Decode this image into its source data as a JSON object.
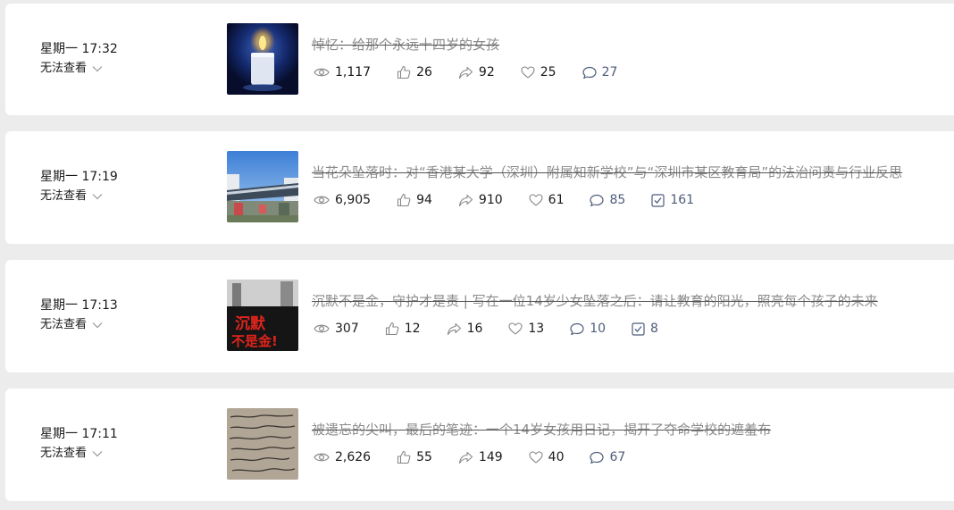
{
  "articles": [
    {
      "time": "星期一 17:32",
      "visibility": "无法查看",
      "title": "悼忆：给那个永远十四岁的女孩",
      "thumbnail": "candle-image",
      "stats": {
        "views": "1,117",
        "likes": "26",
        "shares": "92",
        "favorites": "25",
        "comments": "27"
      }
    },
    {
      "time": "星期一 17:19",
      "visibility": "无法查看",
      "title": "当花朵坠落时：对“香港某大学（深圳）附属知新学校”与“深圳市某区教育局”的法治问责与行业反思",
      "thumbnail": "school-gate-image",
      "stats": {
        "views": "6,905",
        "likes": "94",
        "shares": "910",
        "favorites": "61",
        "comments": "85",
        "checks": "161"
      }
    },
    {
      "time": "星期一 17:13",
      "visibility": "无法查看",
      "title": "沉默不是金，守护才是责 | 写在一位14岁少女坠落之后：请让教育的阳光，照亮每个孩子的未来",
      "thumbnail": "protest-sign-image",
      "thumb_text_1": "沉默",
      "thumb_text_2": "不是金!",
      "stats": {
        "views": "307",
        "likes": "12",
        "shares": "16",
        "favorites": "13",
        "comments": "10",
        "checks": "8"
      }
    },
    {
      "time": "星期一 17:11",
      "visibility": "无法查看",
      "title": "被遗忘的尖叫，最后的笔迹：一个14岁女孩用日记，揭开了夺命学校的遮羞布",
      "thumbnail": "handwritten-diary-image",
      "stats": {
        "views": "2,626",
        "likes": "55",
        "shares": "149",
        "favorites": "40",
        "comments": "67"
      }
    }
  ],
  "colors": {
    "card_bg": "#ffffff",
    "page_bg": "#ececec",
    "title_struck": "#8a8a8a",
    "stat_blue": "#4e5d7a",
    "protest_red": "#e0241c"
  }
}
